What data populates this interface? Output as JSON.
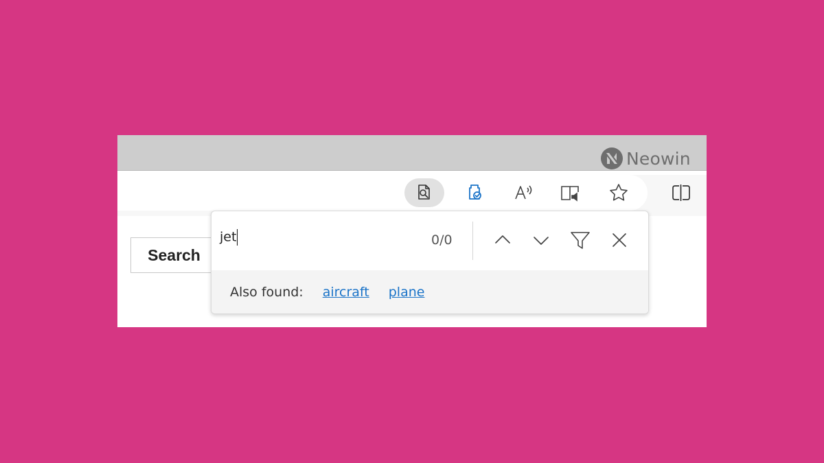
{
  "colors": {
    "background": "#d63683",
    "accent": "#1a73c8",
    "titlebar": "#cdcdcd"
  },
  "watermark": {
    "text": "Neowin"
  },
  "toolbar": {
    "icons": [
      "find-on-page-icon",
      "extension-icon",
      "read-aloud-icon",
      "immersive-reader-icon",
      "favorites-star-icon",
      "split-screen-icon"
    ]
  },
  "page": {
    "search_button": "Search"
  },
  "find_bar": {
    "query": "jet",
    "count": "0/0",
    "also_found_label": "Also found:",
    "suggestions": [
      "aircraft",
      "plane"
    ]
  }
}
